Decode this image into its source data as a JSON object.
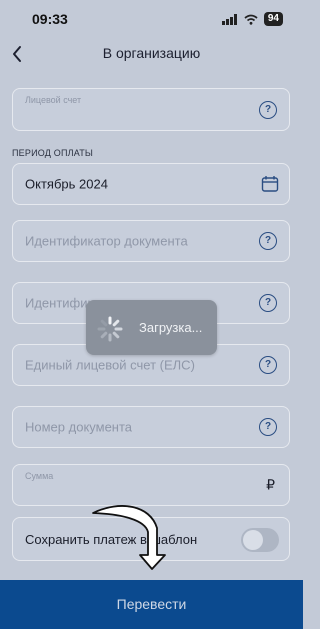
{
  "status": {
    "time": "09:33",
    "battery": "94"
  },
  "header": {
    "title": "В организацию"
  },
  "fields": {
    "account_label": "Лицевой счет",
    "period_label": "ПЕРИОД ОПЛАТЫ",
    "period_value": "Октябрь 2024",
    "doc_id_placeholder": "Идентификатор документа",
    "service_id_placeholder": "Идентификатор услуг",
    "els_placeholder": "Единый лицевой счет (ЕЛС)",
    "doc_number_placeholder": "Номер документа",
    "amount_label": "Сумма",
    "currency_symbol": "₽"
  },
  "save_template": {
    "label": "Сохранить платеж в шаблон",
    "enabled": false
  },
  "actions": {
    "transfer": "Перевести"
  },
  "loader": {
    "text": "Загрузка..."
  }
}
